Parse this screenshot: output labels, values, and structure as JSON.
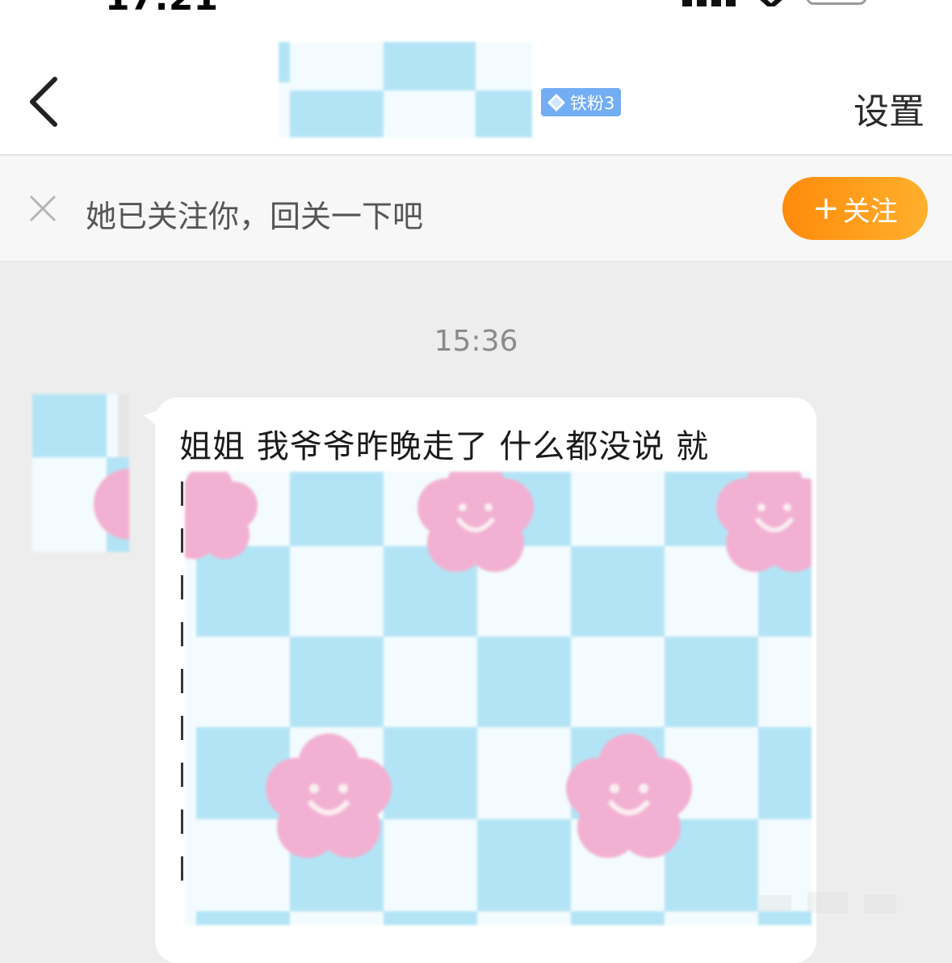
{
  "nav": {
    "badge_label": "铁粉3",
    "settings_label": "设置"
  },
  "banner": {
    "text": "她已关注你，回关一下吧",
    "follow_plus": "+",
    "follow_label": "关注"
  },
  "chat": {
    "timestamp": "15:36",
    "message_visible_text": "姐姐 我爷爷昨晚走了 什么都没说 就"
  },
  "colors": {
    "accent_orange": "#ff8a0a",
    "badge_blue": "#73adf4",
    "mosaic_blue": "#b3e4f5",
    "mosaic_pink": "#f2b1d2"
  }
}
